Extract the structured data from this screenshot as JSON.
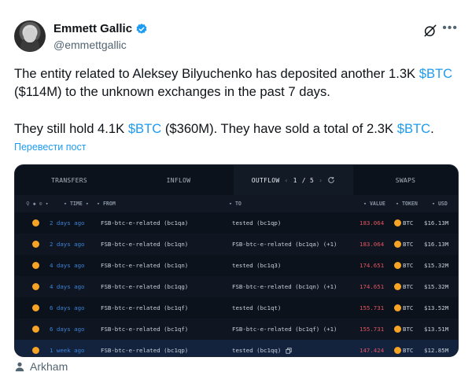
{
  "author": {
    "name": "Emmett Gallic",
    "handle": "@emmettgallic"
  },
  "tweet": {
    "p1_before": "The entity related to Aleksey Bilyuchenko has deposited another 1.3K ",
    "p1_tag": "$BTC",
    "p1_after": " ($114M)  to the unknown exchanges in the past 7 days.",
    "p2_before": "They still hold 4.1K ",
    "p2_tag1": "$BTC",
    "p2_mid": " ($360M). They have sold a total of 2.3K ",
    "p2_tag2": "$BTC",
    "p2_after": ".",
    "translate": "Перевести пост"
  },
  "card": {
    "tabs": {
      "transfers": "TRANSFERS",
      "inflow": "INFLOW",
      "outflow": "OUTFLOW",
      "page_current": "1",
      "page_total": "/ 5",
      "swaps": "SWAPS"
    },
    "columns": {
      "time": "TIME",
      "from": "FROM",
      "to": "TO",
      "value": "VALUE",
      "token": "TOKEN",
      "usd": "USD"
    },
    "rows": [
      {
        "time": "2 days ago",
        "from": "FSB-btc-e-related  (bc1qa)",
        "to": "tested (bc1qp)",
        "value": "183.064",
        "token": "BTC",
        "usd": "$16.13M"
      },
      {
        "time": "2 days ago",
        "from": "FSB-btc-e-related  (bc1qn)",
        "to": "FSB-btc-e-related  (bc1qa) (+1)",
        "value": "183.064",
        "token": "BTC",
        "usd": "$16.13M"
      },
      {
        "time": "4 days ago",
        "from": "FSB-btc-e-related  (bc1qn)",
        "to": "tested (bc1q3)",
        "value": "174.651",
        "token": "BTC",
        "usd": "$15.32M"
      },
      {
        "time": "4 days ago",
        "from": "FSB-btc-e-related  (bc1qg)",
        "to": "FSB-btc-e-related  (bc1qn) (+1)",
        "value": "174.651",
        "token": "BTC",
        "usd": "$15.32M"
      },
      {
        "time": "6 days ago",
        "from": "FSB-btc-e-related  (bc1qf)",
        "to": "tested (bc1qt)",
        "value": "155.731",
        "token": "BTC",
        "usd": "$13.52M"
      },
      {
        "time": "6 days ago",
        "from": "FSB-btc-e-related  (bc1qf)",
        "to": "FSB-btc-e-related  (bc1qf) (+1)",
        "value": "155.731",
        "token": "BTC",
        "usd": "$13.51M"
      },
      {
        "time": "1 week ago",
        "from": "FSB-btc-e-related  (bc1qp)",
        "to": "tested (bc1qq)",
        "value": "147.424",
        "token": "BTC",
        "usd": "$12.85M"
      }
    ]
  },
  "footer": {
    "source": "Arkham"
  },
  "colors": {
    "link": "#1d9bf0",
    "card_bg": "#0c121c",
    "btc_orange": "#f7a325",
    "value_red": "#e1545e",
    "time_blue": "#3b82d6"
  },
  "icons": [
    "avatar",
    "verified-badge-icon",
    "grok-icon",
    "more-icon",
    "refresh-icon",
    "btc-icon",
    "copy-icon",
    "person-icon"
  ]
}
